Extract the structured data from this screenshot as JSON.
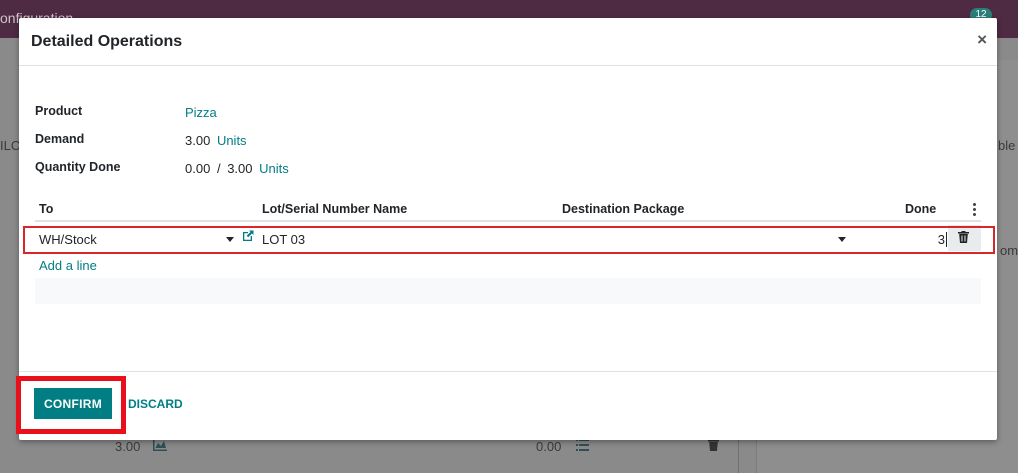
{
  "background": {
    "app_title": "onfiguration",
    "notification_count": "12",
    "left_fragment": "ILO",
    "right_fragment_1": "ble a",
    "right_fragment_2": "om",
    "bottom_qty": "3.00",
    "bottom_done": "0.00"
  },
  "dialog": {
    "title": "Detailed Operations",
    "close_label": "×",
    "fields": {
      "product_label": "Product",
      "product_value": "Pizza",
      "demand_label": "Demand",
      "demand_value": "3.00",
      "demand_uom": "Units",
      "qty_done_label": "Quantity Done",
      "qty_done_value": "0.00",
      "qty_done_sep": "/",
      "qty_done_total": "3.00",
      "qty_done_uom": "Units"
    },
    "table": {
      "columns": [
        "To",
        "Lot/Serial Number Name",
        "Destination Package",
        "Done"
      ],
      "rows": [
        {
          "to": "WH/Stock",
          "lot": "LOT 03",
          "package": "",
          "done": "3"
        }
      ],
      "add_line": "Add a line"
    },
    "buttons": {
      "confirm": "CONFIRM",
      "discard": "DISCARD"
    }
  },
  "colors": {
    "accent": "#017e84",
    "highlight": "#e8101a",
    "topbar": "#4e2a43"
  }
}
